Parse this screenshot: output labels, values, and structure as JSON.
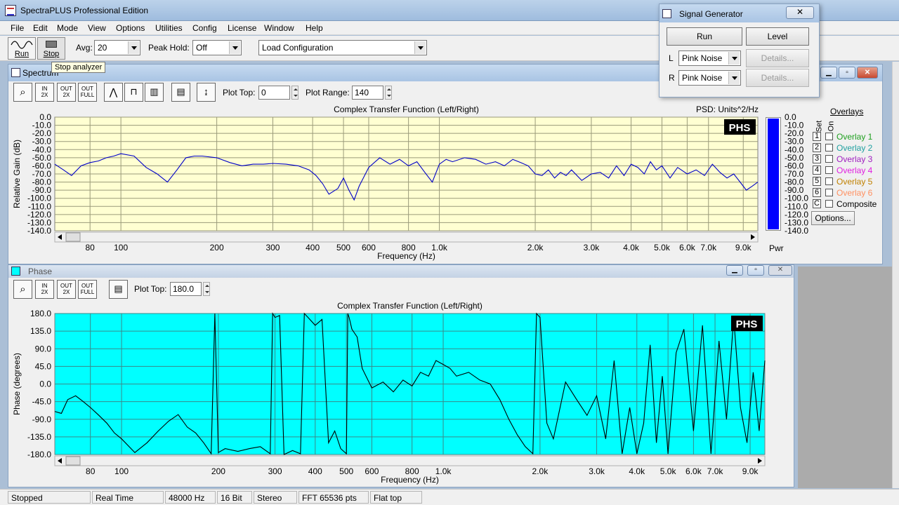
{
  "app": {
    "title": "SpectraPLUS Professional Edition"
  },
  "menu": [
    "File",
    "Edit",
    "Mode",
    "View",
    "Options",
    "Utilities",
    "Config",
    "License",
    "Window",
    "Help"
  ],
  "toolbar": {
    "run_label": "Run",
    "stop_label": "Stop",
    "avg_label": "Avg:",
    "avg_value": "20",
    "peak_label": "Peak Hold:",
    "peak_value": "Off",
    "config_value": "Load Configuration",
    "tooltip": "Stop analyzer"
  },
  "spectrum": {
    "title": "Spectrum",
    "plot_top_label": "Plot Top:",
    "plot_top_value": "0",
    "plot_range_label": "Plot Range:",
    "plot_range_value": "140",
    "buttons": [
      "IN 2X",
      "OUT 2X",
      "OUT FULL"
    ],
    "chart_title": "Complex Transfer Function (Left/Right)",
    "psd_label": "PSD: Units^2/Hz",
    "ylabel": "Relative Gain (dB)",
    "xlabel": "Frequency (Hz)",
    "pwr_label": "Pwr",
    "badge": "PHS",
    "overlays_title": "Overlays",
    "set_label": "Set",
    "on_label": "On",
    "options_button": "Options..."
  },
  "overlays": [
    {
      "num": "1",
      "label": "Overlay 1",
      "color": "#20a020"
    },
    {
      "num": "2",
      "label": "Overlay 2",
      "color": "#20a0a0"
    },
    {
      "num": "3",
      "label": "Overlay 3",
      "color": "#a020c0"
    },
    {
      "num": "4",
      "label": "Overlay 4",
      "color": "#e020e0"
    },
    {
      "num": "5",
      "label": "Overlay 5",
      "color": "#c08000"
    },
    {
      "num": "6",
      "label": "Overlay 6",
      "color": "#ff9060"
    },
    {
      "num": "C",
      "label": "Composite",
      "color": "#000000"
    }
  ],
  "phase": {
    "title": "Phase",
    "plot_top_label": "Plot Top:",
    "plot_top_value": "180.0",
    "chart_title": "Complex Transfer Function (Left/Right)",
    "ylabel": "Phase (degrees)",
    "xlabel": "Frequency (Hz)",
    "badge": "PHS"
  },
  "signal_generator": {
    "title": "Signal Generator",
    "run_label": "Run",
    "level_label": "Level",
    "left_label": "L",
    "right_label": "R",
    "left_value": "Pink Noise",
    "right_value": "Pink Noise",
    "details_label": "Details..."
  },
  "status": [
    "Stopped",
    "Real Time",
    "48000 Hz",
    "16 Bit",
    "Stereo",
    "FFT 65536 pts",
    "Flat top"
  ],
  "colors": {
    "spectrum_bg": "#ffffd2",
    "phase_bg": "#00ffff",
    "trace_spectrum": "#0000c8",
    "trace_phase": "#000000",
    "pwr_bar": "#0000ff"
  },
  "chart_data": [
    {
      "type": "line",
      "title": "Complex Transfer Function (Left/Right)",
      "xlabel": "Frequency (Hz)",
      "ylabel": "Relative Gain (dB)",
      "xscale": "log",
      "xlim": [
        62,
        10000
      ],
      "ylim": [
        -140,
        0
      ],
      "grid": true,
      "x_tick_labels": [
        "80",
        "100",
        "200",
        "300",
        "400",
        "500",
        "600",
        "800",
        "1.0k",
        "2.0k",
        "3.0k",
        "4.0k",
        "5.0k",
        "6.0k",
        "7.0k",
        "9.0k"
      ],
      "x_ticks": [
        80,
        100,
        200,
        300,
        400,
        500,
        600,
        800,
        1000,
        2000,
        3000,
        4000,
        5000,
        6000,
        7000,
        9000
      ],
      "y_ticks": [
        0,
        -10,
        -20,
        -30,
        -40,
        -50,
        -60,
        -70,
        -80,
        -90,
        -100,
        -110,
        -120,
        -130,
        -140
      ],
      "y_tick_labels": [
        "0.0",
        "-10.0",
        "-20.0",
        "-30.0",
        "-40.0",
        "-50.0",
        "-60.0",
        "-70.0",
        "-80.0",
        "-90.0",
        "-100.0",
        "-110.0",
        "-120.0",
        "-130.0",
        "-140.0"
      ],
      "series": [
        {
          "x": [
            62,
            66,
            70,
            75,
            80,
            85,
            90,
            95,
            100,
            110,
            120,
            130,
            140,
            150,
            160,
            170,
            180,
            200,
            220,
            240,
            260,
            280,
            300,
            330,
            360,
            390,
            410,
            430,
            450,
            480,
            500,
            520,
            540,
            560,
            600,
            650,
            700,
            750,
            800,
            850,
            900,
            950,
            1000,
            1050,
            1100,
            1200,
            1300,
            1400,
            1500,
            1600,
            1700,
            1800,
            1900,
            2000,
            2100,
            2200,
            2300,
            2400,
            2500,
            2600,
            2800,
            3000,
            3200,
            3400,
            3600,
            3800,
            4000,
            4200,
            4400,
            4600,
            4800,
            5000,
            5300,
            5600,
            6000,
            6400,
            6800,
            7200,
            7600,
            8000,
            8400,
            8800,
            9200,
            9600,
            10000
          ],
          "y": [
            -58,
            -65,
            -72,
            -60,
            -56,
            -54,
            -50,
            -48,
            -45,
            -48,
            -62,
            -70,
            -80,
            -65,
            -50,
            -48,
            -48,
            -50,
            -56,
            -60,
            -58,
            -58,
            -57,
            -58,
            -60,
            -65,
            -72,
            -82,
            -95,
            -88,
            -75,
            -90,
            -102,
            -85,
            -62,
            -50,
            -58,
            -52,
            -60,
            -55,
            -68,
            -80,
            -58,
            -52,
            -55,
            -50,
            -52,
            -58,
            -55,
            -60,
            -52,
            -56,
            -60,
            -70,
            -72,
            -65,
            -75,
            -68,
            -72,
            -65,
            -78,
            -70,
            -68,
            -75,
            -60,
            -72,
            -58,
            -62,
            -70,
            -55,
            -65,
            -60,
            -75,
            -62,
            -70,
            -65,
            -72,
            -58,
            -68,
            -75,
            -70,
            -80,
            -90,
            -85,
            -80
          ]
        }
      ]
    },
    {
      "type": "line",
      "title": "Complex Transfer Function (Left/Right)",
      "xlabel": "Frequency (Hz)",
      "ylabel": "Phase (degrees)",
      "xscale": "log",
      "xlim": [
        62,
        10000
      ],
      "ylim": [
        -180,
        180
      ],
      "grid": true,
      "x_tick_labels": [
        "80",
        "100",
        "200",
        "300",
        "400",
        "500",
        "600",
        "800",
        "1.0k",
        "2.0k",
        "3.0k",
        "4.0k",
        "5.0k",
        "6.0k",
        "7.0k",
        "9.0k"
      ],
      "x_ticks": [
        80,
        100,
        200,
        300,
        400,
        500,
        600,
        800,
        1000,
        2000,
        3000,
        4000,
        5000,
        6000,
        7000,
        9000
      ],
      "y_ticks": [
        180,
        135,
        90,
        45,
        0,
        -45,
        -90,
        -135,
        -180
      ],
      "y_tick_labels": [
        "180.0",
        "135.0",
        "90.0",
        "45.0",
        "0.0",
        "-45.0",
        "-90.0",
        "-135.0",
        "-180.0"
      ],
      "series": [
        {
          "x": [
            62,
            65,
            68,
            72,
            76,
            80,
            85,
            90,
            95,
            100,
            110,
            120,
            130,
            140,
            150,
            160,
            170,
            180,
            190,
            195,
            200,
            210,
            230,
            250,
            270,
            290,
            295,
            300,
            310,
            320,
            340,
            360,
            370,
            380,
            400,
            420,
            440,
            460,
            480,
            500,
            505,
            510,
            520,
            540,
            560,
            600,
            650,
            700,
            750,
            800,
            850,
            900,
            950,
            1000,
            1050,
            1100,
            1200,
            1300,
            1400,
            1500,
            1600,
            1700,
            1800,
            1900,
            1950,
            2000,
            2100,
            2200,
            2400,
            2600,
            2800,
            3000,
            3200,
            3400,
            3600,
            3800,
            4000,
            4200,
            4400,
            4600,
            4800,
            5000,
            5300,
            5600,
            6000,
            6400,
            6800,
            7200,
            7600,
            8000,
            8400,
            8800,
            9200,
            9600,
            10000
          ],
          "y": [
            -70,
            -75,
            -40,
            -30,
            -45,
            -60,
            -80,
            -100,
            -125,
            -140,
            -175,
            -150,
            -120,
            -95,
            -78,
            -110,
            -125,
            -150,
            -178,
            180,
            -175,
            -165,
            -172,
            -165,
            -160,
            -178,
            180,
            170,
            175,
            -180,
            -170,
            -178,
            180,
            170,
            150,
            165,
            -150,
            -120,
            -165,
            -178,
            180,
            170,
            140,
            120,
            40,
            -10,
            5,
            -20,
            10,
            -5,
            30,
            20,
            60,
            50,
            40,
            20,
            30,
            10,
            0,
            -40,
            -90,
            -130,
            -160,
            -178,
            180,
            170,
            -100,
            -140,
            5,
            -40,
            -80,
            -30,
            -140,
            60,
            -178,
            -60,
            -178,
            -100,
            100,
            -150,
            20,
            -178,
            80,
            140,
            -120,
            150,
            -178,
            110,
            -90,
            170,
            -60,
            -150,
            30,
            -120,
            60
          ]
        }
      ]
    }
  ]
}
